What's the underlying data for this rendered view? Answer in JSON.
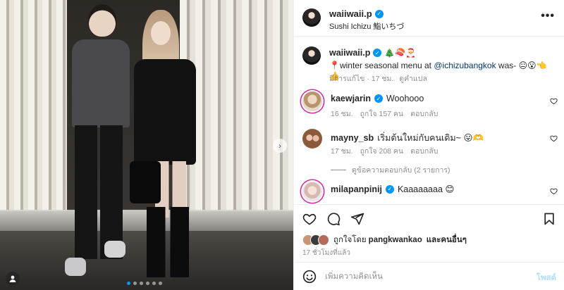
{
  "post": {
    "username": "waiiwaii.p",
    "location": "Sushi Ichizu 鮨いちづ",
    "more": "•••"
  },
  "caption": {
    "username": "waiiwaii.p",
    "username_emojis": "🎄🍣🎅",
    "text_before": "📍winter seasonal menu at ",
    "mention": "@ichizubangkok",
    "text_after": " was- 😐😮👈👍",
    "edited": "มีการแก้ไข · 17 ชม.",
    "translate": "ดูคำแปล"
  },
  "comments": [
    {
      "username": "kaewjarin",
      "verified": true,
      "text": "Woohooo",
      "age": "16 ชม.",
      "likes": "ถูกใจ 157 คน",
      "reply": "ตอบกลับ"
    },
    {
      "username": "mayny_sb",
      "verified": false,
      "text": "เริ่มต้นใหม่กับคนเดิม~ 😛🫶",
      "age": "17 ชม.",
      "likes": "ถูกใจ 208 คน",
      "reply": "ตอบกลับ"
    },
    {
      "username": "milapanpinij",
      "verified": true,
      "text": "Kaaaaaaaa 😊"
    }
  ],
  "view_replies": "ดูข้อความตอบกลับ (2 รายการ)",
  "likes_line": {
    "prefix": "ถูกใจโดย",
    "user": "pangkwankao",
    "suffix": "และคนอื่นๆ"
  },
  "timestamp": "17 ชั่วโมงที่แล้ว",
  "compose": {
    "placeholder": "เพิ่มความคิดเห็น",
    "post_label": "โพสต์"
  },
  "carousel": {
    "dots": 6,
    "active_index": 0
  },
  "colors": {
    "accent": "#0095f6",
    "text": "#262626",
    "muted": "#8e8e8e",
    "mention": "#00376b"
  }
}
